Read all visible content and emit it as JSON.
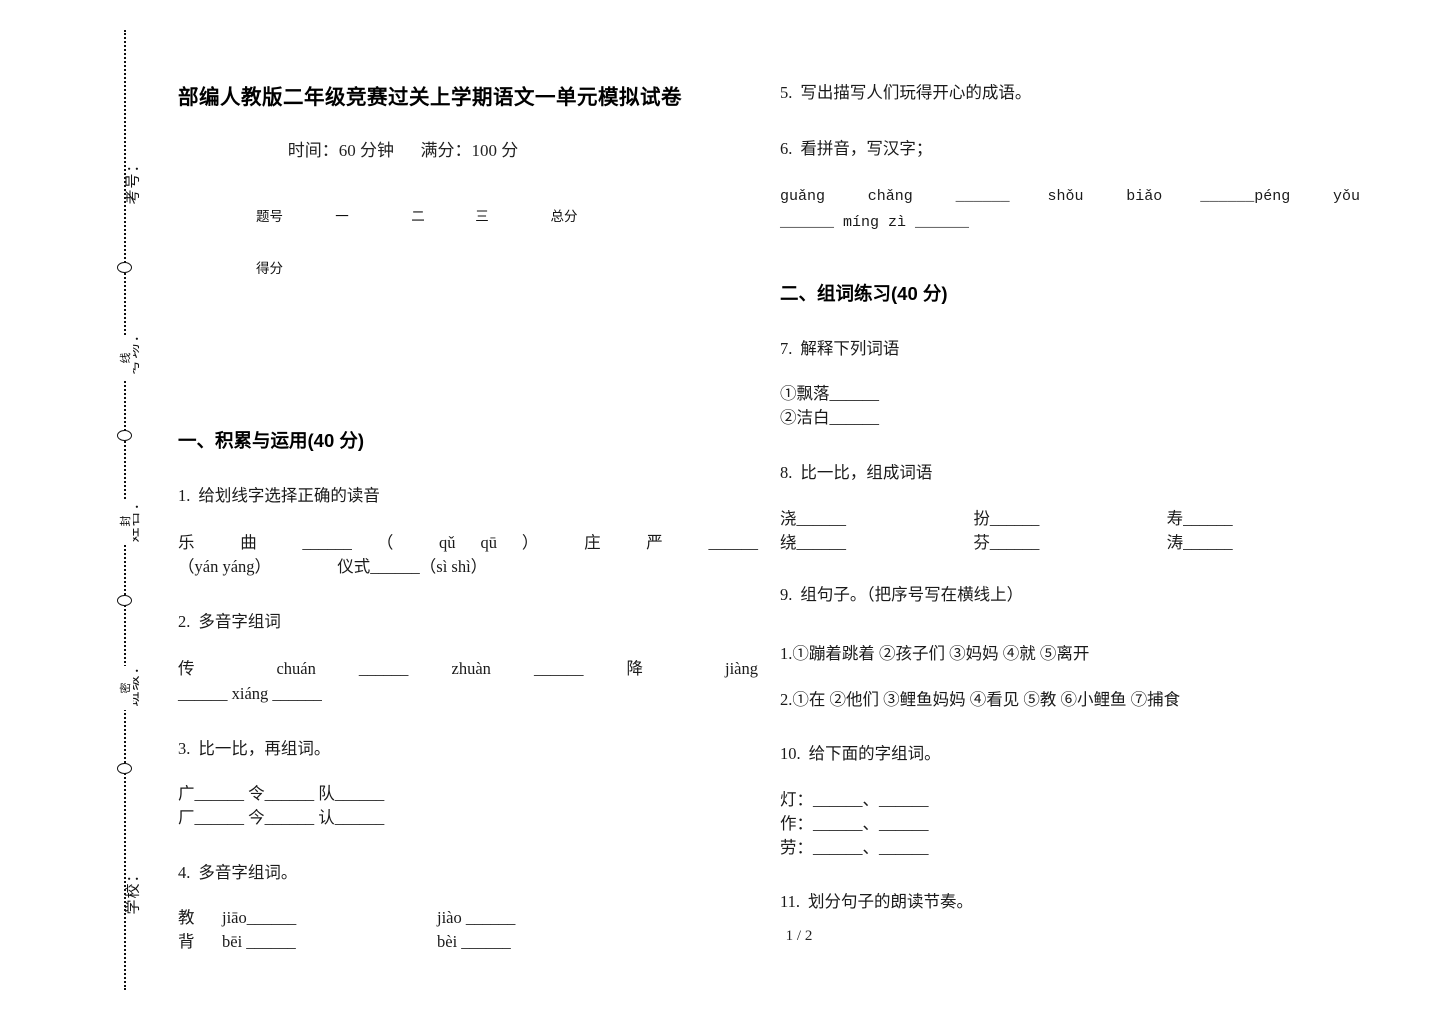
{
  "document": {
    "title": "部编人教版二年级竞赛过关上学期语文一单元模拟试卷",
    "meta_time_label": "时间：60 分钟",
    "meta_score_label": "满分：100 分",
    "footer": "1 / 2"
  },
  "seal_strip": {
    "vertical_labels": [
      {
        "text": "考号："
      },
      {
        "text": "考场："
      },
      {
        "text": "姓名："
      },
      {
        "text": "班级："
      },
      {
        "text": "学校："
      }
    ],
    "small_chars": [
      {
        "text": "线"
      },
      {
        "text": "封"
      },
      {
        "text": "密"
      }
    ]
  },
  "score_table": {
    "header": [
      "题号",
      "一",
      "二",
      "三",
      "总分"
    ],
    "row_label": "得分",
    "row_values": [
      "",
      "",
      "",
      ""
    ]
  },
  "sections": {
    "one": {
      "heading": "一、积累与运用(40 分)"
    },
    "two": {
      "heading": "二、组词练习(40 分)"
    }
  },
  "questions": {
    "q1": {
      "number": "1.",
      "text": "给划线字选择正确的读音",
      "line1": "乐 曲 ______ （ qǔ    qū ）",
      "line1b": "庄 严 ______",
      "line2": "（yán    yáng）",
      "line2b": "仪式______（sì    shì）"
    },
    "q2": {
      "number": "2.",
      "text": "多音字组词",
      "line1a": "传  chuán  ______",
      "line1b": "zhuàn  ______",
      "line1c": "降  jiàng",
      "line2": "______    xiáng ______"
    },
    "q3": {
      "number": "3.",
      "text": "比一比，再组词。",
      "row1": "广______ 令______ 队______",
      "row2": "厂______ 今______ 认______"
    },
    "q4": {
      "number": "4.",
      "text": "多音字组词。",
      "row1a": "教",
      "row1b": "jiāo______",
      "row1c": "jiào ______",
      "row2a": "背",
      "row2b": "bēi ______",
      "row2c": "bèi  ______"
    },
    "q5": {
      "number": "5.",
      "text": "写出描写人们玩得开心的成语。"
    },
    "q6": {
      "number": "6.",
      "text": "看拼音，写汉字；",
      "line1a": "guǎng   chǎng   ______",
      "line1b": "shǒu  biǎo",
      "line1c": "______péng  yǒu",
      "line2": "______    míng zì ______"
    },
    "q7": {
      "number": "7.",
      "text": "解释下列词语",
      "item1": "①飘落______",
      "item2": "②洁白______"
    },
    "q8": {
      "number": "8.",
      "text": "比一比，组成词语",
      "cols": [
        {
          "top": "浇______",
          "bottom": "绕______"
        },
        {
          "top": "扮______",
          "bottom": "芬______"
        },
        {
          "top": "寿______",
          "bottom": "涛______"
        }
      ]
    },
    "q9": {
      "number": "9.",
      "text": "组句子。（把序号写在横线上）",
      "item1": "1.①蹦着跳着 ②孩子们 ③妈妈 ④就 ⑤离开",
      "item2": "2.①在 ②他们 ③鲤鱼妈妈 ④看见 ⑤教 ⑥小鲤鱼 ⑦捕食"
    },
    "q10": {
      "number": "10.",
      "text": "给下面的字组词。",
      "row1": "灯：______、______",
      "row2": "作：______、______",
      "row3": "劳：______、______"
    },
    "q11": {
      "number": "11.",
      "text": "划分句子的朗读节奏。"
    }
  }
}
